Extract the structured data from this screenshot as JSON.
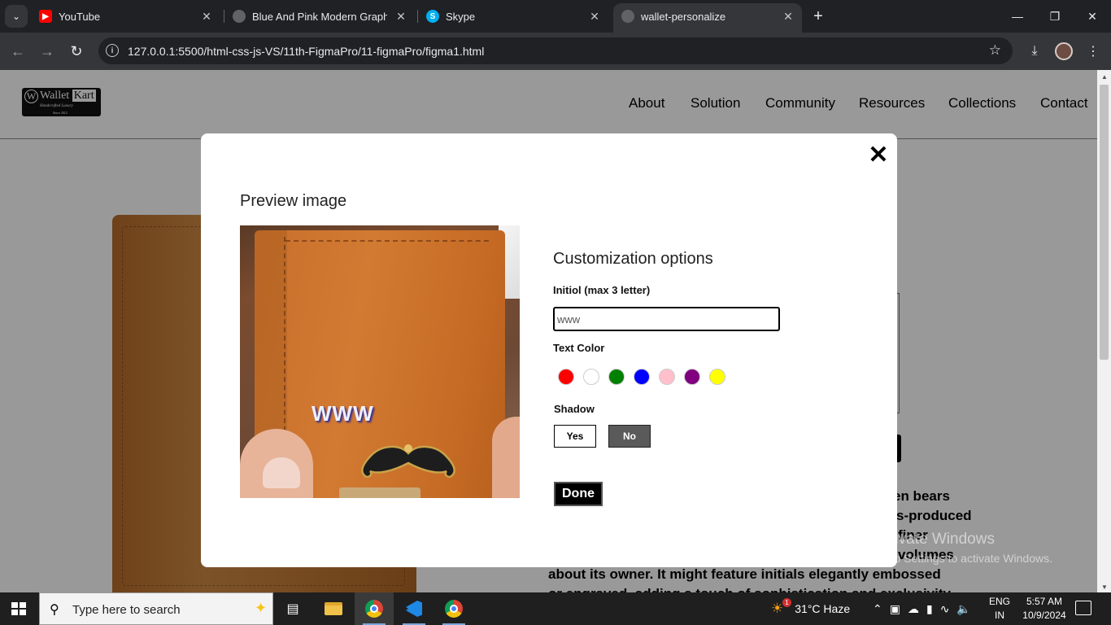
{
  "browser": {
    "tabs": [
      {
        "title": "YouTube",
        "icon": "youtube-icon"
      },
      {
        "title": "Blue And Pink Modern Graphic",
        "icon": "globe-icon"
      },
      {
        "title": "Skype",
        "icon": "skype-icon"
      },
      {
        "title": "wallet-personalize",
        "icon": "globe-icon",
        "active": true
      }
    ],
    "url": "127.0.0.1:5500/html-css-js-VS/11th-FigmaPro/11-figmaPro/figma1.html"
  },
  "site": {
    "logo": {
      "w": "W",
      "name_a": "Wallet",
      "name_b": "Kart",
      "tagline": "Handcrafted Luxury",
      "since": "Since 2012"
    },
    "nav": [
      "About",
      "Solution",
      "Community",
      "Resources",
      "Collections",
      "Contact"
    ],
    "description_lines": [
      "en bears",
      "s-produced",
      "finer",
      "volumes",
      "about its owner. It might feature initials elegantly embossed",
      "or engraved, adding a touch of sophistication and exclusivity"
    ]
  },
  "modal": {
    "close_symbol": "✕",
    "preview_title": "Preview image",
    "preview_text": "WWW",
    "customization_title": "Customization options",
    "initial_label": "Initiol (max 3 letter)",
    "initial_value": "www",
    "text_color_label": "Text Color",
    "colors": [
      {
        "name": "red",
        "hex": "#ff0000"
      },
      {
        "name": "white",
        "hex": "#ffffff"
      },
      {
        "name": "green",
        "hex": "#008000"
      },
      {
        "name": "blue",
        "hex": "#0000ff"
      },
      {
        "name": "pink",
        "hex": "#ffc0cb"
      },
      {
        "name": "purple",
        "hex": "#800080"
      },
      {
        "name": "yellow",
        "hex": "#ffff00"
      }
    ],
    "shadow_label": "Shadow",
    "shadow_yes": "Yes",
    "shadow_no": "No",
    "shadow_selected": "No",
    "done_label": "Done"
  },
  "watermark": {
    "line1": "Activate Windows",
    "line2": "Go to Settings to activate Windows."
  },
  "taskbar": {
    "search_placeholder": "Type here to search",
    "weather": "31°C  Haze",
    "weather_badge": "1",
    "lang_top": "ENG",
    "lang_bottom": "IN",
    "time": "5:57 AM",
    "date": "10/9/2024"
  }
}
